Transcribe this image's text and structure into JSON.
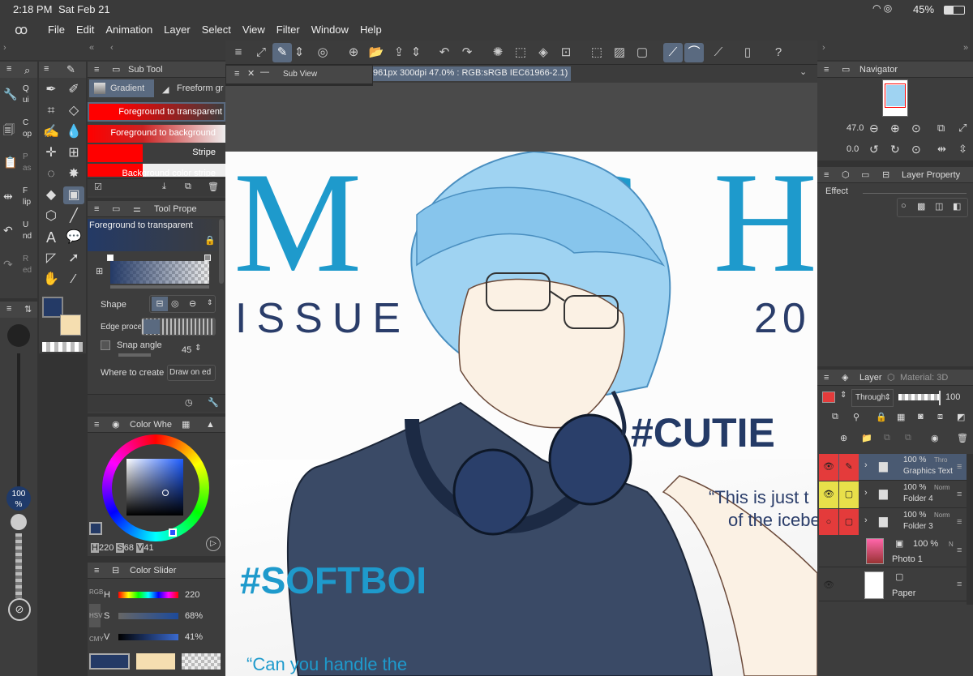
{
  "status": {
    "time": "2:18 PM",
    "date": "Sat Feb 21",
    "battery": "45%"
  },
  "menu": [
    "File",
    "Edit",
    "Animation",
    "Layer",
    "Select",
    "View",
    "Filter",
    "Window",
    "Help"
  ],
  "left_quick": {
    "items": [
      {
        "letter": "Q",
        "sub": "ui"
      },
      {
        "letter": "C",
        "sub": "op"
      },
      {
        "letter": "P",
        "sub": "as"
      },
      {
        "letter": "F",
        "sub": "lip"
      },
      {
        "letter": "U",
        "sub": "nd"
      },
      {
        "letter": "R",
        "sub": "ed"
      }
    ]
  },
  "brush_size": {
    "value": "100",
    "unit": "%"
  },
  "subtool": {
    "title": "Sub Tool",
    "tabs": [
      "Gradient",
      "Freeform gr"
    ],
    "items": [
      "Foreground to transparent",
      "Foreground to background",
      "Stripe",
      "Background color stripe"
    ]
  },
  "subview": {
    "title": "Sub View"
  },
  "doc_info": "961px 300dpi 47.0% : RGB:sRGB IEC61966-2.1)",
  "tool_property": {
    "title": "Tool Prope",
    "name": "Foreground to transparent",
    "shape_label": "Shape",
    "edge_label": "Edge proces",
    "snap_label": "Snap angle",
    "snap_value": "45",
    "where_label": "Where to create",
    "where_value": "Draw on ed"
  },
  "color_wheel": {
    "title": "Color Whe",
    "h": "220",
    "s": "68",
    "v": "41",
    "h_label": "H",
    "s_label": "S",
    "v_label": "V"
  },
  "color_slider": {
    "title": "Color Slider",
    "h_label": "H",
    "h_value": "220",
    "s_label": "S",
    "s_value": "68%",
    "v_label": "V",
    "v_value": "41%",
    "tabs": [
      "RGB",
      "HSV",
      "CMY"
    ]
  },
  "colors": {
    "main": "#243a66",
    "sub": "#f5deb0"
  },
  "navigator": {
    "title": "Navigator",
    "zoom": "47.0",
    "rotate": "0.0"
  },
  "layer_property": {
    "title": "Layer Property",
    "effect_label": "Effect"
  },
  "layer_panel": {
    "tabs": [
      "Layer",
      "Material: 3D"
    ],
    "blend": "Through",
    "opacity": "100",
    "layers": [
      {
        "pct": "100 %",
        "mode": "Thro",
        "name": "Graphics Text",
        "type": "folder"
      },
      {
        "pct": "100 %",
        "mode": "Norm",
        "name": "Folder 4",
        "type": "folder"
      },
      {
        "pct": "100 %",
        "mode": "Norm",
        "name": "Folder 3",
        "type": "folder"
      },
      {
        "pct": "100 %",
        "mode": "N",
        "name": "Photo 1",
        "type": "photo"
      },
      {
        "pct": "",
        "mode": "",
        "name": "Paper",
        "type": "paper"
      }
    ]
  },
  "artwork": {
    "big_title": "M CH",
    "issue": "ISSUE",
    "year": "20",
    "hashtag1": "#CUTIE",
    "quote1_l1": "“This is just t",
    "quote1_l2": "of the icebe",
    "hashtag2": "#SOFTBOI",
    "quote2": "“Can you handle the"
  }
}
